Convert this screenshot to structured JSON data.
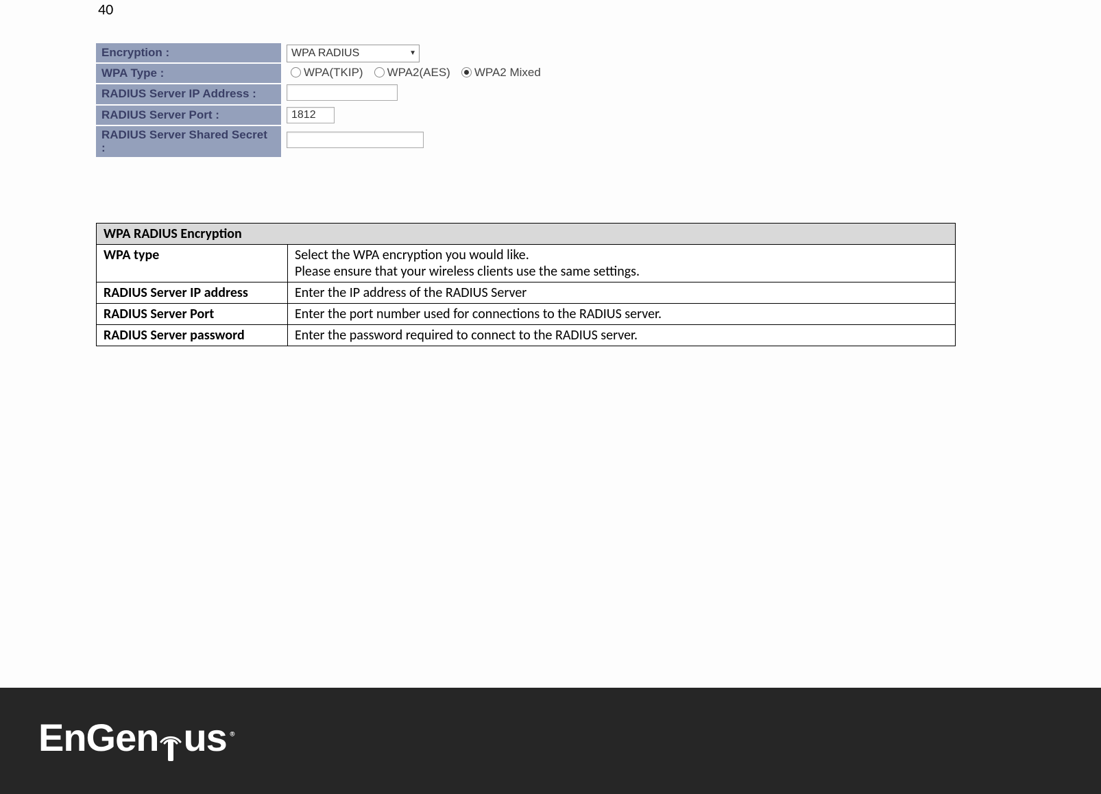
{
  "page_number": "40",
  "config": {
    "rows": [
      {
        "label": "Encryption :"
      },
      {
        "label": "WPA Type :"
      },
      {
        "label": "RADIUS Server IP Address :"
      },
      {
        "label": "RADIUS Server Port :"
      },
      {
        "label": "RADIUS Server Shared Secret :"
      }
    ],
    "encryption_select": "WPA RADIUS",
    "wpa_options": {
      "tkip": "WPA(TKIP)",
      "aes": "WPA2(AES)",
      "mixed": "WPA2 Mixed"
    },
    "wpa_selected": "mixed",
    "ip_value": "",
    "port_value": "1812",
    "secret_value": ""
  },
  "desc": {
    "header": "WPA RADIUS Encryption",
    "rows": [
      {
        "key": "WPA type",
        "val": "Select the WPA encryption you would like.\nPlease ensure that your wireless clients use the same settings."
      },
      {
        "key": "RADIUS Server IP address",
        "val": "Enter the IP address of the RADIUS Server"
      },
      {
        "key": "RADIUS Server Port",
        "val": "Enter the port number used for connections to the RADIUS server."
      },
      {
        "key": "RADIUS Server password",
        "val": "Enter the password required to connect to the RADIUS server."
      }
    ]
  },
  "footer": {
    "brand_pre": "EnGen",
    "brand_post": "us",
    "reg": "®"
  }
}
